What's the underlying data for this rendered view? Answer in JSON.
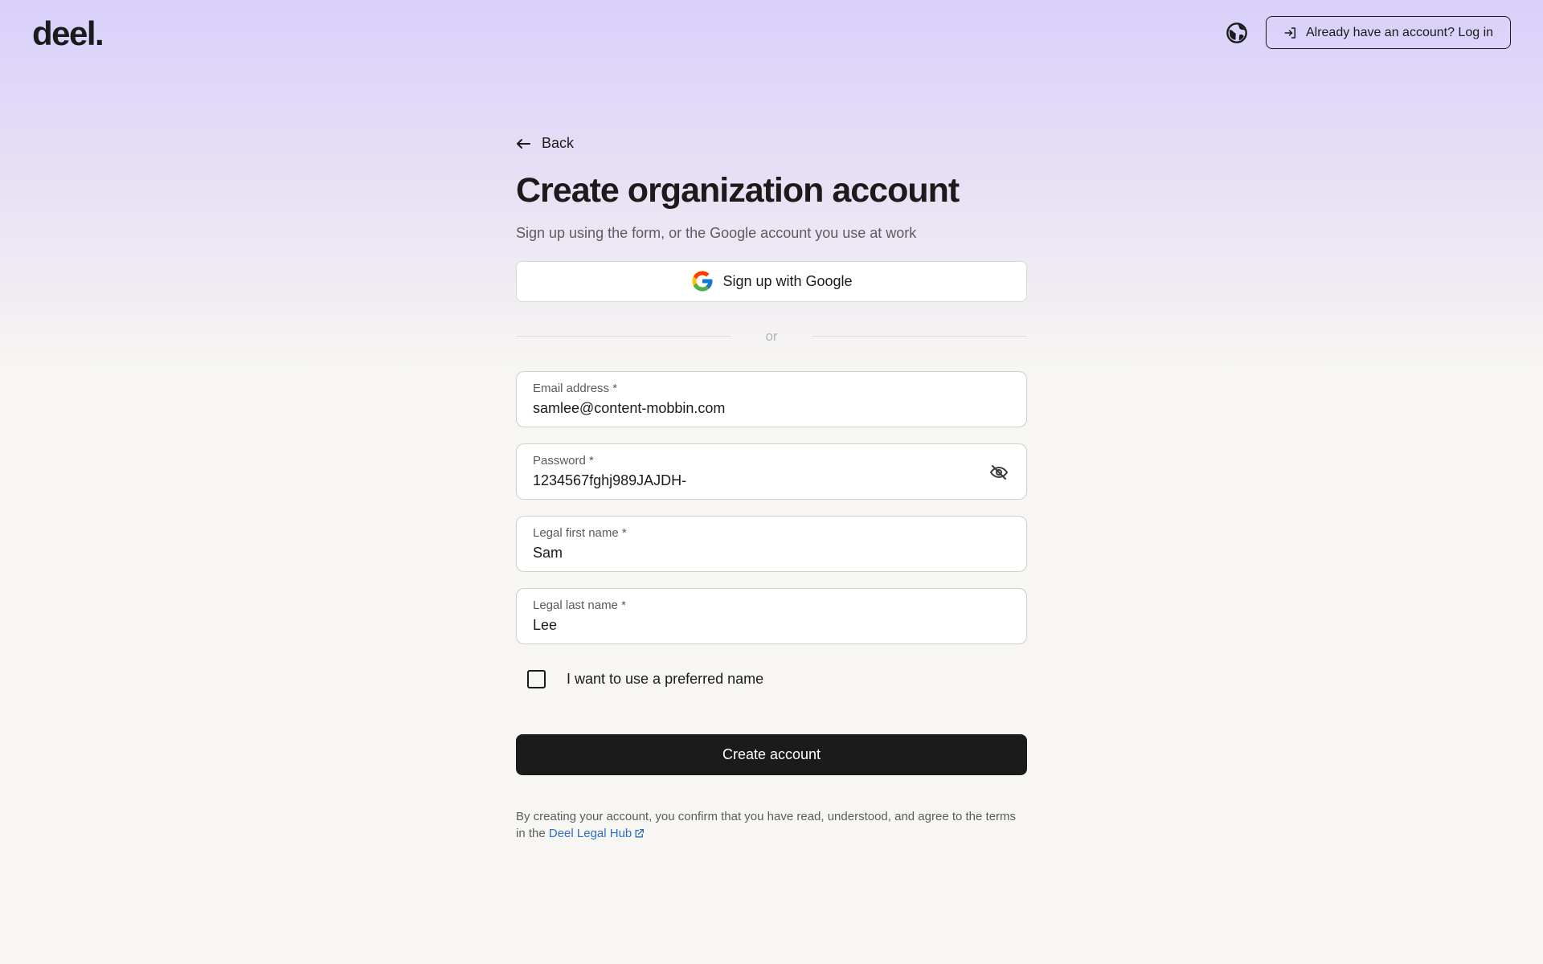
{
  "header": {
    "logo": "deel.",
    "login_label": "Already have an account? Log in"
  },
  "form": {
    "back_label": "Back",
    "title": "Create organization account",
    "subtitle": "Sign up using the form, or the Google account you use at work",
    "google_label": "Sign up with Google",
    "divider_label": "or",
    "email": {
      "label": "Email address *",
      "value": "samlee@content-mobbin.com"
    },
    "password": {
      "label": "Password *",
      "value": "1234567fghj989JAJDH-"
    },
    "first_name": {
      "label": "Legal first name *",
      "value": "Sam"
    },
    "last_name": {
      "label": "Legal last name *",
      "value": "Lee"
    },
    "preferred_name_label": "I want to use a preferred name",
    "submit_label": "Create account",
    "legal_text": "By creating your account, you confirm that you have read, understood, and agree to the terms in the ",
    "legal_link": "Deel Legal Hub"
  },
  "colors": {
    "primary": "#1b1b1b",
    "link": "#2e6fc1",
    "gradient_top": "#d9d0fb",
    "background": "#f7f6f2"
  },
  "icons": {
    "language": "globe-icon",
    "login": "login-arrow-icon",
    "back": "arrow-left-icon",
    "google": "google-g-icon",
    "password_toggle": "eye-off-icon",
    "external": "external-link-icon"
  }
}
